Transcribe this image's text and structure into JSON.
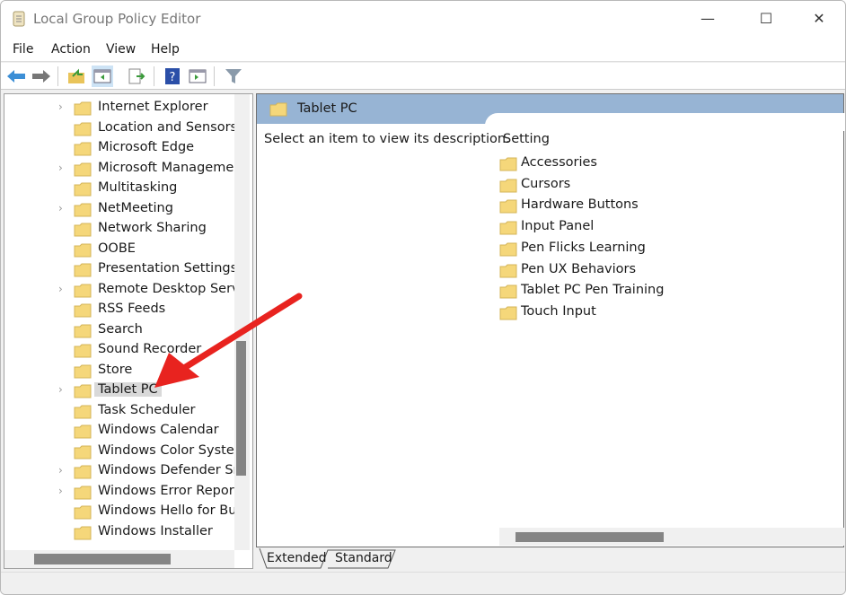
{
  "window": {
    "title": "Local Group Policy Editor",
    "app_icon": "policy-scroll-icon",
    "controls": [
      "minimize-icon",
      "maximize-icon",
      "close-icon"
    ]
  },
  "menu": [
    "File",
    "Action",
    "View",
    "Help"
  ],
  "toolbar": [
    "back-arrow-icon",
    "forward-arrow-icon",
    "up-folder-icon",
    "show-hide-tree-icon",
    "export-list-icon",
    "help-icon",
    "show-hide-action-pane-icon",
    "filter-icon"
  ],
  "tree": {
    "items": [
      {
        "label": "Internet Explorer",
        "expandable": true
      },
      {
        "label": "Location and Sensors",
        "expandable": false
      },
      {
        "label": "Microsoft Edge",
        "expandable": false
      },
      {
        "label": "Microsoft Managemen",
        "expandable": true
      },
      {
        "label": "Multitasking",
        "expandable": false
      },
      {
        "label": "NetMeeting",
        "expandable": true
      },
      {
        "label": "Network Sharing",
        "expandable": false
      },
      {
        "label": "OOBE",
        "expandable": false
      },
      {
        "label": "Presentation Settings",
        "expandable": false
      },
      {
        "label": "Remote Desktop Servic",
        "expandable": true
      },
      {
        "label": "RSS Feeds",
        "expandable": false
      },
      {
        "label": "Search",
        "expandable": false
      },
      {
        "label": "Sound Recorder",
        "expandable": false
      },
      {
        "label": "Store",
        "expandable": false
      },
      {
        "label": "Tablet PC",
        "expandable": true,
        "selected": true
      },
      {
        "label": "Task Scheduler",
        "expandable": false
      },
      {
        "label": "Windows Calendar",
        "expandable": false
      },
      {
        "label": "Windows Color System",
        "expandable": false
      },
      {
        "label": "Windows Defender Sm",
        "expandable": true
      },
      {
        "label": "Windows Error Reportir",
        "expandable": true
      },
      {
        "label": "Windows Hello for Bus",
        "expandable": false
      },
      {
        "label": "Windows Installer",
        "expandable": false
      }
    ]
  },
  "details": {
    "header": "Tablet PC",
    "description": "Select an item to view its description.",
    "column": "Setting",
    "settings": [
      "Accessories",
      "Cursors",
      "Hardware Buttons",
      "Input Panel",
      "Pen Flicks Learning",
      "Pen UX Behaviors",
      "Tablet PC Pen Training",
      "Touch Input"
    ]
  },
  "tabs": [
    "Extended",
    "Standard"
  ],
  "colors": {
    "header": "#97b4d4",
    "folder": "#f5d77a",
    "annotation_arrow": "#e8231f",
    "selection": "#d9d9d9"
  }
}
